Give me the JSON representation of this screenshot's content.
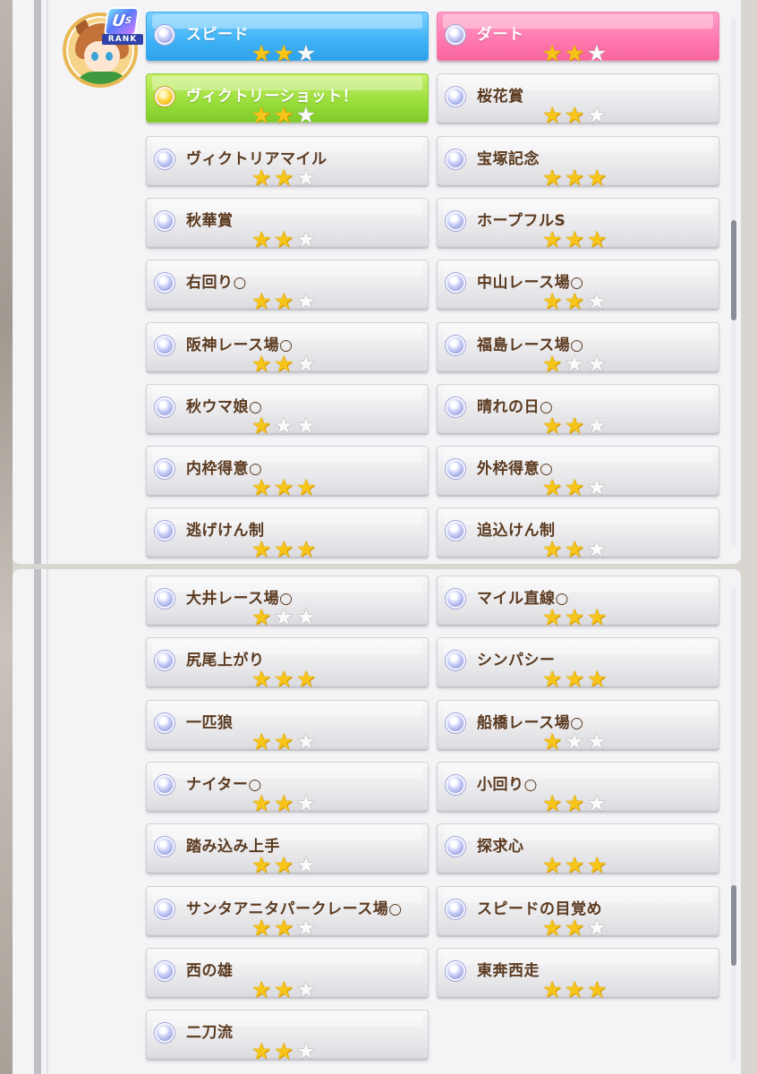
{
  "rank_badge": {
    "rank_text": "U",
    "rank_sub": "S",
    "label": "RANK"
  },
  "section1": [
    {
      "name": "スピード",
      "stars": 2,
      "style": "blue",
      "col": 0,
      "row": 0
    },
    {
      "name": "ダート",
      "stars": 2,
      "style": "pink",
      "col": 1,
      "row": 0
    },
    {
      "name": "ヴィクトリーショット！",
      "stars": 2,
      "style": "gold",
      "col": 0,
      "row": 1
    },
    {
      "name": "桜花賞",
      "stars": 2,
      "style": "normal",
      "col": 1,
      "row": 1
    },
    {
      "name": "ヴィクトリアマイル",
      "stars": 2,
      "style": "normal",
      "col": 0,
      "row": 2
    },
    {
      "name": "宝塚記念",
      "stars": 3,
      "style": "normal",
      "col": 1,
      "row": 2
    },
    {
      "name": "秋華賞",
      "stars": 2,
      "style": "normal",
      "col": 0,
      "row": 3
    },
    {
      "name": "ホープフルS",
      "stars": 3,
      "style": "normal",
      "col": 1,
      "row": 3
    },
    {
      "name": "右回り○",
      "stars": 2,
      "style": "normal",
      "col": 0,
      "row": 4
    },
    {
      "name": "中山レース場○",
      "stars": 2,
      "style": "normal",
      "col": 1,
      "row": 4
    },
    {
      "name": "阪神レース場○",
      "stars": 2,
      "style": "normal",
      "col": 0,
      "row": 5
    },
    {
      "name": "福島レース場○",
      "stars": 1,
      "style": "normal",
      "col": 1,
      "row": 5
    },
    {
      "name": "秋ウマ娘○",
      "stars": 1,
      "style": "normal",
      "col": 0,
      "row": 6
    },
    {
      "name": "晴れの日○",
      "stars": 2,
      "style": "normal",
      "col": 1,
      "row": 6
    },
    {
      "name": "内枠得意○",
      "stars": 3,
      "style": "normal",
      "col": 0,
      "row": 7
    },
    {
      "name": "外枠得意○",
      "stars": 2,
      "style": "normal",
      "col": 1,
      "row": 7
    },
    {
      "name": "逃げけん制",
      "stars": 3,
      "style": "normal",
      "col": 0,
      "row": 8
    },
    {
      "name": "追込けん制",
      "stars": 2,
      "style": "normal",
      "col": 1,
      "row": 8
    }
  ],
  "section2": [
    {
      "name": "大井レース場○",
      "stars": 1,
      "col": 0,
      "row": 0
    },
    {
      "name": "マイル直線○",
      "stars": 3,
      "col": 1,
      "row": 0
    },
    {
      "name": "尻尾上がり",
      "stars": 3,
      "col": 0,
      "row": 1
    },
    {
      "name": "シンパシー",
      "stars": 3,
      "col": 1,
      "row": 1
    },
    {
      "name": "一匹狼",
      "stars": 2,
      "col": 0,
      "row": 2
    },
    {
      "name": "船橋レース場○",
      "stars": 1,
      "col": 1,
      "row": 2
    },
    {
      "name": "ナイター○",
      "stars": 2,
      "col": 0,
      "row": 3
    },
    {
      "name": "小回り○",
      "stars": 2,
      "col": 1,
      "row": 3
    },
    {
      "name": "踏み込み上手",
      "stars": 2,
      "col": 0,
      "row": 4
    },
    {
      "name": "探求心",
      "stars": 3,
      "col": 1,
      "row": 4
    },
    {
      "name": "サンタアニタパークレース場○",
      "stars": 2,
      "col": 0,
      "row": 5
    },
    {
      "name": "スピードの目覚め",
      "stars": 2,
      "col": 1,
      "row": 5
    },
    {
      "name": "西の雄",
      "stars": 2,
      "col": 0,
      "row": 6
    },
    {
      "name": "東奔西走",
      "stars": 3,
      "col": 1,
      "row": 6
    },
    {
      "name": "二刀流",
      "stars": 2,
      "col": 0,
      "row": 7
    }
  ],
  "icons": {
    "skill_dot": "skill-orb-icon",
    "unique_dot": "unique-skill-orb-icon",
    "star": "star-icon"
  },
  "colors": {
    "star_on": "#f7c51a",
    "star_off": "#fafafa",
    "text_brown": "#5b3a1f",
    "speed_blue": "#3fb2f6",
    "dirt_pink": "#ff78ad",
    "unique_green": "#98dd3a"
  }
}
